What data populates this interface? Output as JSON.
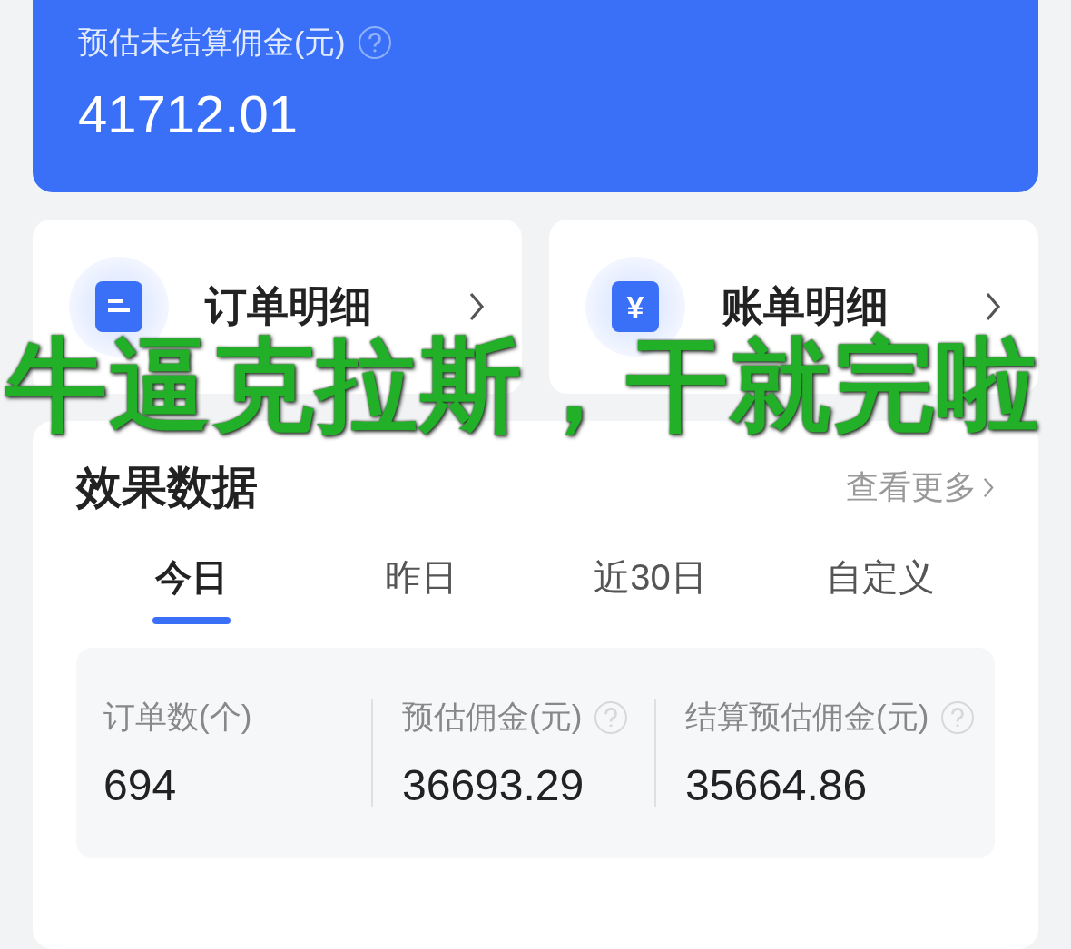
{
  "commission": {
    "label": "预估未结算佣金(元)",
    "amount": "41712.01"
  },
  "shortcuts": [
    {
      "kind": "order",
      "label": "订单明细"
    },
    {
      "kind": "bill",
      "label": "账单明细",
      "icon_text": "¥"
    }
  ],
  "effect": {
    "title": "效果数据",
    "more": "查看更多",
    "tabs": [
      {
        "label": "今日",
        "selected": true
      },
      {
        "label": "昨日",
        "selected": false
      },
      {
        "label": "近30日",
        "selected": false
      },
      {
        "label": "自定义",
        "selected": false
      }
    ],
    "stats": [
      {
        "label": "订单数(个)",
        "value": "694",
        "help": false
      },
      {
        "label": "预估佣金(元)",
        "value": "36693.29",
        "help": true
      },
      {
        "label": "结算预估佣金(元)",
        "value": "35664.86",
        "help": true
      }
    ]
  },
  "caption": "牛逼克拉斯，干就完啦"
}
